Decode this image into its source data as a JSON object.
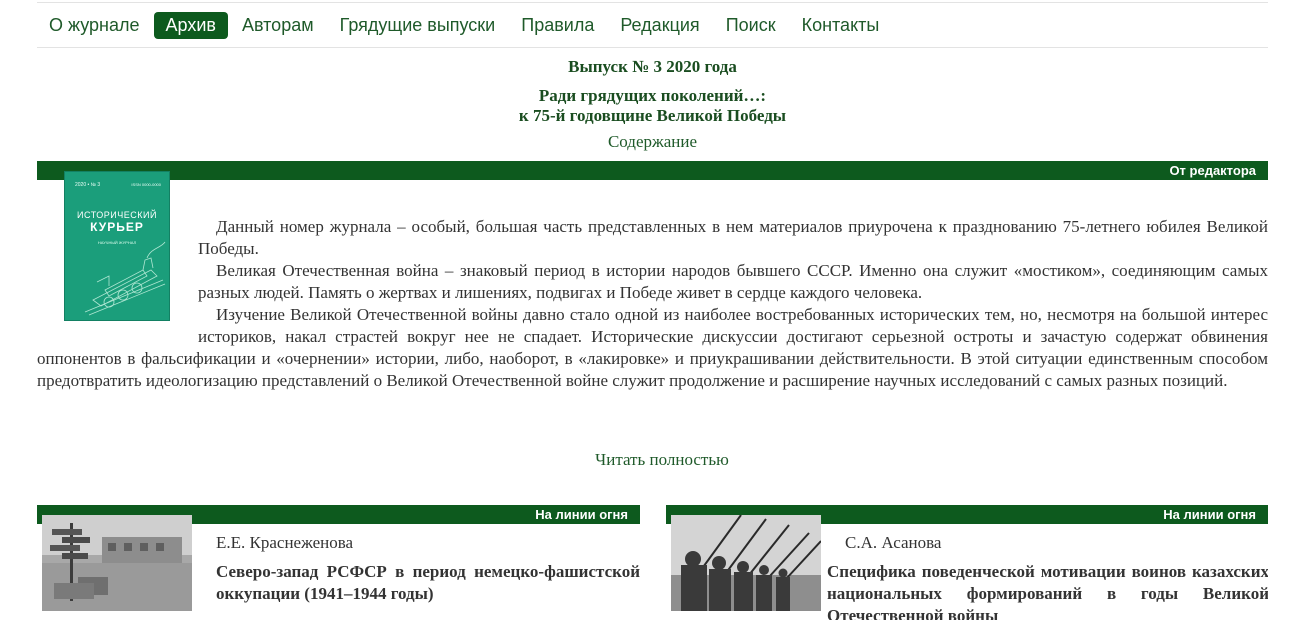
{
  "nav": {
    "items": [
      {
        "label": "О журнале"
      },
      {
        "label": "Архив"
      },
      {
        "label": "Авторам"
      },
      {
        "label": "Грядущие выпуски"
      },
      {
        "label": "Правила"
      },
      {
        "label": "Редакция"
      },
      {
        "label": "Поиск"
      },
      {
        "label": "Контакты"
      }
    ],
    "active": "Архив"
  },
  "issue": {
    "title": "Выпуск № 3 2020 года",
    "subtitle_line1": "Ради грядущих поколений…:",
    "subtitle_line2": "к 75-й годовщине Великой Победы",
    "contents_link": "Содержание"
  },
  "editorial": {
    "section_label": "От редактора",
    "cover": {
      "top_left": "2020 • № 3",
      "top_right": "ISSN 0000-0000",
      "line1": "ИСТОРИЧЕСКИЙ",
      "line2": "КУРЬЕР",
      "line3": "НАУЧНЫЙ ЖУРНАЛ"
    },
    "paragraphs": [
      "Данный номер журнала – особый, большая часть представленных в нем материалов приурочена к празднованию 75-летнего юбилея Великой Победы.",
      "Великая Отечественная война – знаковый период в истории народов бывшего СССР. Именно она служит «мостиком», соединяющим самых разных людей. Память о жертвах и лишениях, подвигах и Победе живет в сердце каждого человека.",
      "Изучение Великой Отечественной войны давно стало одной из наиболее востребованных исторических тем, но, несмотря на большой интерес историков, накал страстей вокруг нее не спадает. Исторические дискуссии достигают серьезной остроты и зачастую содержат обвинения оппонентов в фальсификации и «очернении» истории, либо, наоборот, в «лакировке» и приукрашивании действительности. В этой ситуации единственным способом предотвратить идеологизацию представлений о Великой Отечественной войне служит продолжение и расширение научных исследований с самых разных позиций."
    ],
    "read_more": "Читать полностью"
  },
  "articles": [
    {
      "section_label": "На линии огня",
      "author": "Е.Е. Краснеженова",
      "title": "Северо-запад РСФСР в период немецко-фашистской оккупации (1941–1944 годы)",
      "thumb_icon": "street-photo"
    },
    {
      "section_label": "На линии огня",
      "author": "С.А. Асанова",
      "title": "Специфика поведенческой мотивации воинов казахских национальных формирований в годы Великой Отечественной войны",
      "thumb_icon": "soldiers-photo"
    }
  ],
  "colors": {
    "brand_green": "#0d5a1e",
    "link_green": "#1f5a2a",
    "cover_teal": "#1b9e7b"
  }
}
